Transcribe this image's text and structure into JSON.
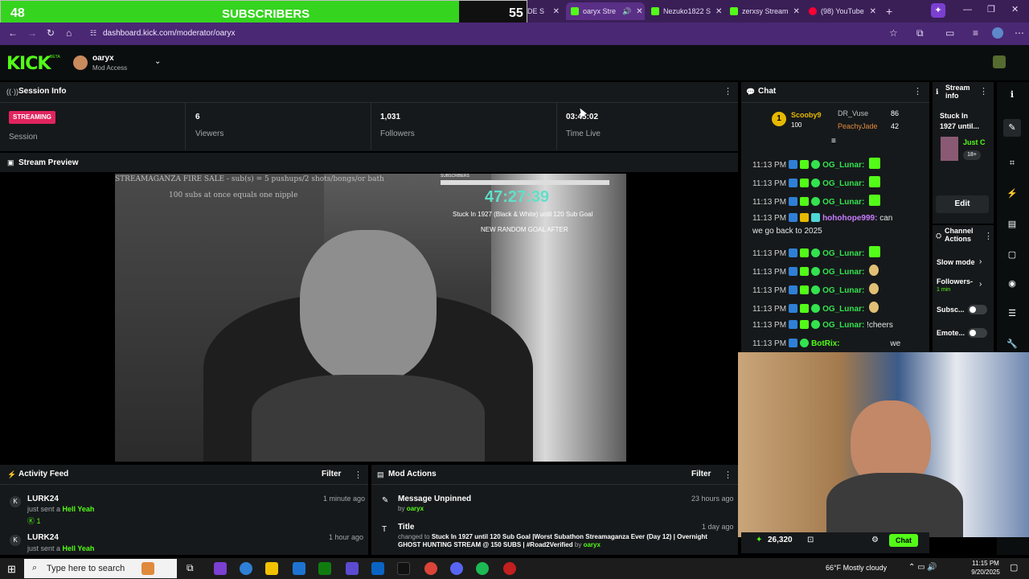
{
  "overlay": {
    "count": "48",
    "label": "SUBSCRIBERS",
    "goal": "55"
  },
  "tabs": [
    {
      "label": "SE MODE S",
      "color": "#53fc18"
    },
    {
      "label": "oaryx Stre",
      "color": "#53fc18"
    },
    {
      "label": "Nezuko1822 S",
      "color": "#53fc18"
    },
    {
      "label": "zerxsy Stream",
      "color": "#53fc18"
    },
    {
      "label": "(98) YouTube",
      "color": "#ff0033"
    }
  ],
  "browser": {
    "url": "dashboard.kick.com/moderator/oaryx"
  },
  "kick": {
    "logo": "KICK",
    "beta": "BETA",
    "user": "oaryx",
    "role": "Mod Access"
  },
  "session": {
    "title": "Session Info",
    "status": "STREAMING",
    "status_label": "Session",
    "viewers": "6",
    "viewers_label": "Viewers",
    "followers": "1,031",
    "followers_label": "Followers",
    "time": "03:45:02",
    "time_label": "Time Live"
  },
  "preview": {
    "title": "Stream Preview",
    "overlay_sale": "STREAMAGANZA FIRE SALE - sub(s) = 5 pushups/2 shots/bongs/or bath",
    "overlay_sale2": "100 subs at once equals one nipple",
    "timer": "47:27:39",
    "goal_text": "Stuck In 1927 (Black & White) until 120 Sub Goal",
    "next_goal": "NEW RANDOM GOAL AFTER",
    "subs_label": "SUBSCRIBERS"
  },
  "activity": {
    "title": "Activity Feed",
    "filter": "Filter",
    "items": [
      {
        "user": "LURK24",
        "text": "just sent a",
        "gift": "Hell Yeah",
        "count": "1",
        "time": "1 minute ago"
      },
      {
        "user": "LURK24",
        "text": "just sent a",
        "gift": "Hell Yeah",
        "time": "1 hour ago"
      }
    ]
  },
  "mod": {
    "title": "Mod Actions",
    "filter": "Filter",
    "items": [
      {
        "title": "Message Unpinned",
        "by": "by",
        "user": "oaryx",
        "time": "23 hours ago"
      },
      {
        "title": "Title",
        "by": "changed to",
        "detail": "Stuck In 1927 until 120 Sub Goal |Worst Subathon Streamaganza Ever (Day 12) | Overnight GHOST HUNTING STREAM @ 150 SUBS | #Road2Verified",
        "by2": "by",
        "user": "oaryx",
        "time": "1 day ago"
      }
    ]
  },
  "chat": {
    "title": "Chat",
    "top": [
      {
        "rank": "1",
        "name": "Scooby9",
        "amount": "100"
      },
      {
        "name": "DR_Vuse",
        "amount": "86"
      },
      {
        "name": "PeachyJade",
        "amount": "42"
      }
    ],
    "lines": [
      {
        "time": "11:13 PM",
        "user": "OG_Lunar:",
        "msg": ""
      },
      {
        "time": "11:13 PM",
        "user": "OG_Lunar:",
        "msg": ""
      },
      {
        "time": "11:13 PM",
        "user": "OG_Lunar:",
        "msg": ""
      },
      {
        "time": "11:13 PM",
        "user": "hohohope999:",
        "msg": "can",
        "msg2": "we go back to 2025"
      },
      {
        "time": "11:13 PM",
        "user": "OG_Lunar:",
        "msg": ""
      },
      {
        "time": "11:13 PM",
        "user": "OG_Lunar:",
        "msg": ""
      },
      {
        "time": "11:13 PM",
        "user": "OG_Lunar:",
        "msg": ""
      },
      {
        "time": "11:13 PM",
        "user": "OG_Lunar:",
        "msg": ""
      },
      {
        "time": "11:13 PM",
        "user": "OG_Lunar:",
        "msg": "!cheers"
      },
      {
        "time": "11:13 PM",
        "user": "BotRix:",
        "msg": "we"
      }
    ],
    "points": "26,320",
    "send": "Chat"
  },
  "stream_info": {
    "title": "Stream info",
    "text": "Stuck In 1927 until...",
    "category": "Just C",
    "age": "18+",
    "edit": "Edit"
  },
  "channel_actions": {
    "title": "Channel Actions",
    "items": [
      {
        "label": "Slow mode"
      },
      {
        "label": "Followers-",
        "sub": "1 min"
      },
      {
        "label": "Subsc..."
      },
      {
        "label": "Emote..."
      }
    ]
  },
  "taskbar": {
    "search": "Type here to search",
    "weather": "66°F  Mostly cloudy",
    "time": "11:15 PM",
    "date": "9/20/2025"
  }
}
